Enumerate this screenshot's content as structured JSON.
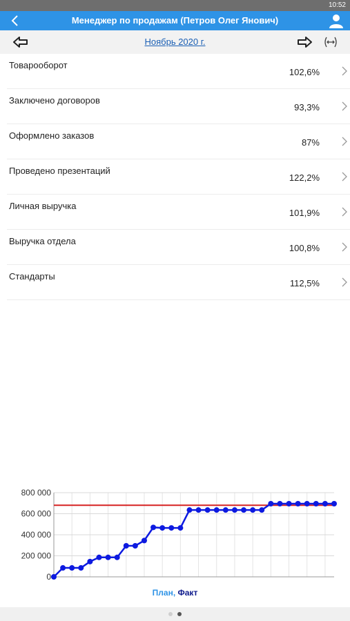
{
  "status_bar": {
    "time": "10:52"
  },
  "header": {
    "title": "Менеджер по продажам (Петров Олег Янович)"
  },
  "period": {
    "label": "Ноябрь 2020 г."
  },
  "kpis": [
    {
      "name": "Товарооборот",
      "value": "102,6%"
    },
    {
      "name": "Заключено договоров",
      "value": "93,3%"
    },
    {
      "name": "Оформлено заказов",
      "value": "87%"
    },
    {
      "name": "Проведено презентаций",
      "value": "122,2%"
    },
    {
      "name": "Личная выручка",
      "value": "101,9%"
    },
    {
      "name": "Выручка отдела",
      "value": "100,8%"
    },
    {
      "name": "Стандарты",
      "value": "112,5%"
    }
  ],
  "legend": {
    "plan": "План,",
    "fact": "Факт"
  },
  "pager": {
    "pages": 2,
    "current": 2
  },
  "colors": {
    "accent": "#2e93e6",
    "plan": "#d62020",
    "fact": "#0d1ae0",
    "fact_label": "#0d1a8c"
  },
  "chart_data": {
    "type": "line",
    "y_ticks": [
      "0",
      "200 000",
      "400 000",
      "600 000",
      "800 000"
    ],
    "ylim": [
      0,
      800000
    ],
    "grid": true,
    "series": [
      {
        "name": "План",
        "type": "hline",
        "value": 680000
      },
      {
        "name": "Факт",
        "values": [
          0,
          85000,
          85000,
          85000,
          145000,
          185000,
          185000,
          185000,
          295000,
          295000,
          345000,
          470000,
          465000,
          465000,
          465000,
          635000,
          635000,
          635000,
          635000,
          635000,
          635000,
          635000,
          635000,
          635000,
          695000,
          695000,
          695000,
          695000,
          695000,
          695000,
          695000,
          695000
        ]
      }
    ]
  }
}
